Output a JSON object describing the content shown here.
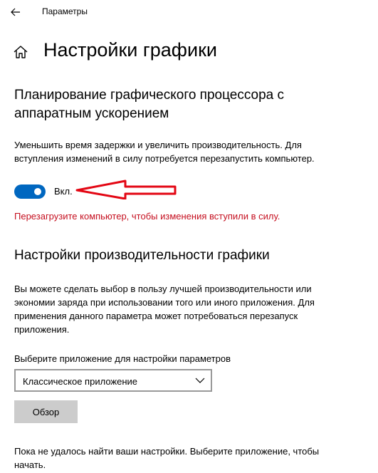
{
  "window": {
    "title": "Параметры"
  },
  "page": {
    "title": "Настройки графики"
  },
  "hags": {
    "title": "Планирование графического процессора с аппаратным ускорением",
    "description": "Уменьшить время задержки и увеличить производительность. Для вступления изменений в силу потребуется перезапустить компьютер.",
    "toggle_state": "Вкл.",
    "toggle_on": true,
    "warning": "Перезагрузите компьютер, чтобы изменения вступили в силу."
  },
  "graphics_performance": {
    "title": "Настройки производительности графики",
    "description": "Вы можете сделать выбор в пользу лучшей производительности или экономии заряда при использовании того или иного приложения. Для применения данного параметра может потребоваться перезапуск приложения.",
    "select_label": "Выберите приложение для настройки параметров",
    "select_value": "Классическое приложение",
    "browse_button": "Обзор",
    "footer": "Пока не удалось найти ваши настройки. Выберите приложение, чтобы начать."
  },
  "colors": {
    "accent": "#0067c0",
    "warning": "#c50f1f",
    "annotation_arrow": "#e30613"
  },
  "icons": {
    "back": "arrow-left-icon",
    "home": "home-icon",
    "chevron": "chevron-down-icon"
  }
}
